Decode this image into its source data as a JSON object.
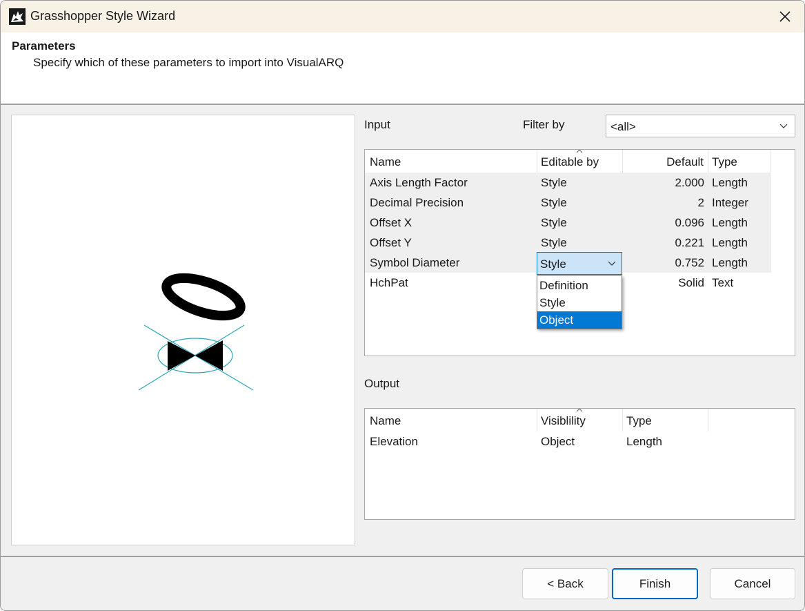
{
  "window": {
    "title": "Grasshopper Style Wizard",
    "icon": "rhino-icon",
    "close_icon": "close-icon"
  },
  "header": {
    "title": "Parameters",
    "subtitle": "Specify which of these parameters to import into VisualARQ"
  },
  "input": {
    "label": "Input",
    "filter_label": "Filter by",
    "filter_value": "<all>",
    "columns": {
      "name": "Name",
      "editable_by": "Editable by",
      "default": "Default",
      "type": "Type"
    },
    "rows": [
      {
        "name": "Axis Length Factor",
        "editable_by": "Style",
        "default": "2.000",
        "type": "Length"
      },
      {
        "name": "Decimal Precision",
        "editable_by": "Style",
        "default": "2",
        "type": "Integer"
      },
      {
        "name": "Offset X",
        "editable_by": "Style",
        "default": "0.096",
        "type": "Length"
      },
      {
        "name": "Offset Y",
        "editable_by": "Style",
        "default": "0.221",
        "type": "Length"
      },
      {
        "name": "Symbol Diameter",
        "editable_by": "Style",
        "default": "0.752",
        "type": "Length"
      },
      {
        "name": "HchPat",
        "editable_by": "",
        "default": "Solid",
        "type": "Text"
      }
    ],
    "dropdown_options": [
      "Definition",
      "Style",
      "Object"
    ],
    "dropdown_highlighted": "Object"
  },
  "output": {
    "label": "Output",
    "columns": {
      "name": "Name",
      "visibility": "Visiblility",
      "type": "Type"
    },
    "rows": [
      {
        "name": "Elevation",
        "visibility": "Object",
        "type": "Length"
      }
    ]
  },
  "buttons": {
    "back": "< Back",
    "finish": "Finish",
    "cancel": "Cancel"
  },
  "colors": {
    "accent": "#0078d4",
    "symbol_line": "#2aa6b8",
    "titlebar": "#f8f2e6"
  }
}
